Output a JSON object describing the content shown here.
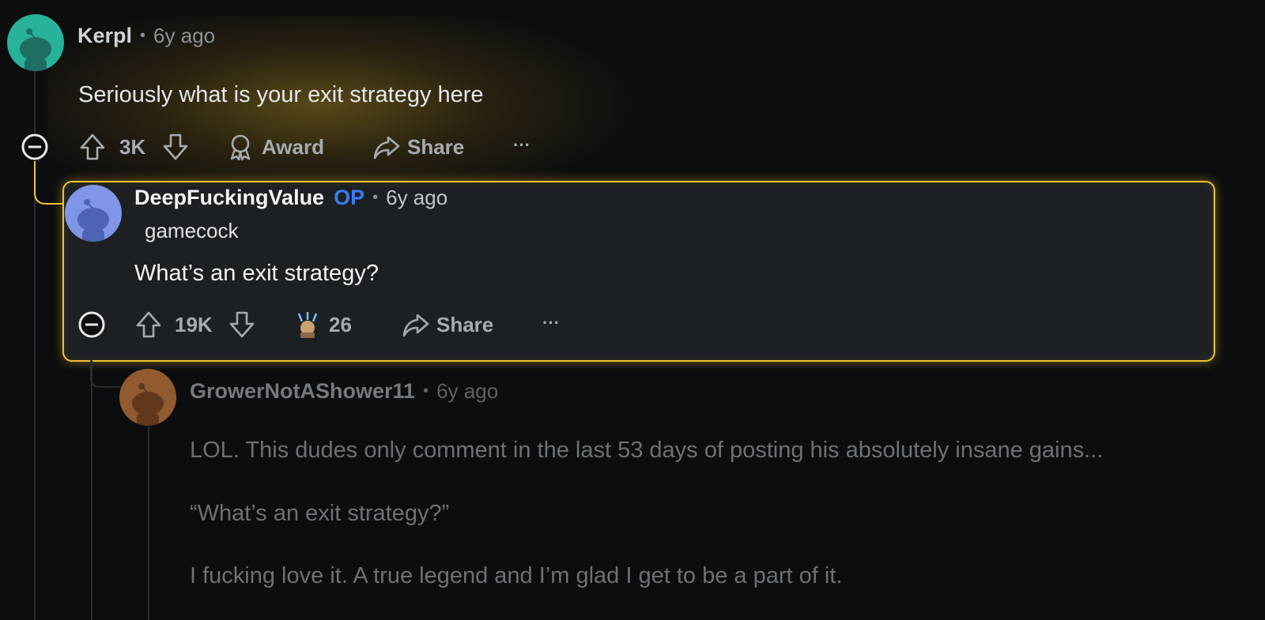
{
  "comments": [
    {
      "username": "Kerpl",
      "time": "6y ago",
      "body": "Seriously what is your exit strategy here",
      "actions": {
        "votes": "3K",
        "award_label": "Award",
        "share_label": "Share",
        "more": "···"
      },
      "avatar_color": "#27b39a"
    },
    {
      "username": "DeepFuckingValue",
      "op_badge": "OP",
      "time": "6y ago",
      "flair": "gamecock",
      "body": "What’s an exit strategy?",
      "actions": {
        "votes": "19K",
        "awards_count": "26",
        "share_label": "Share",
        "more": "···"
      },
      "avatar_color": "#7f95e6"
    },
    {
      "username": "GrowerNotAShower11",
      "time": "6y ago",
      "body_lines": [
        "LOL. This dudes only comment in the last 53 days of posting his absolutely insane gains...",
        "“What’s an exit strategy?”",
        "I fucking love it. A true legend and I’m glad I get to be a part of it."
      ],
      "avatar_color": "#c0743a"
    }
  ],
  "colors": {
    "highlight": "#f2c230",
    "op": "#3b7bf0",
    "background": "#0b0d0f"
  }
}
